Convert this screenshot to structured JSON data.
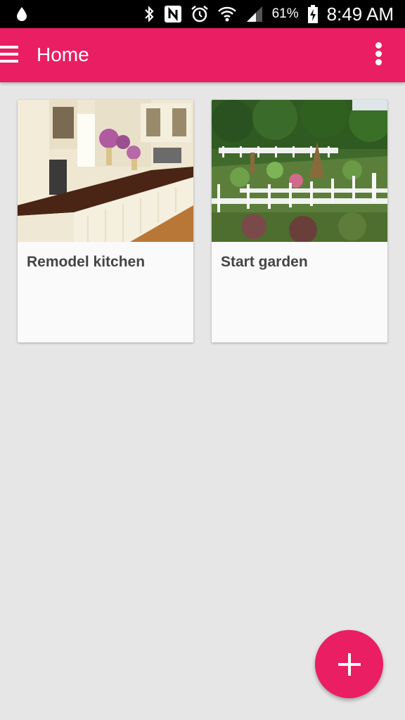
{
  "status_bar": {
    "battery_percent": "61%",
    "time": "8:49 AM",
    "icons": [
      "water-drop-icon",
      "bluetooth-icon",
      "nfc-icon",
      "alarm-icon",
      "wifi-icon",
      "signal-icon",
      "battery-charging-icon"
    ]
  },
  "app_bar": {
    "title": "Home",
    "background_color": "#e91e63"
  },
  "cards": [
    {
      "title": "Remodel kitchen",
      "image": "kitchen-photo"
    },
    {
      "title": "Start garden",
      "image": "garden-photo"
    }
  ],
  "fab": {
    "icon": "plus-icon",
    "color": "#e91e63"
  }
}
